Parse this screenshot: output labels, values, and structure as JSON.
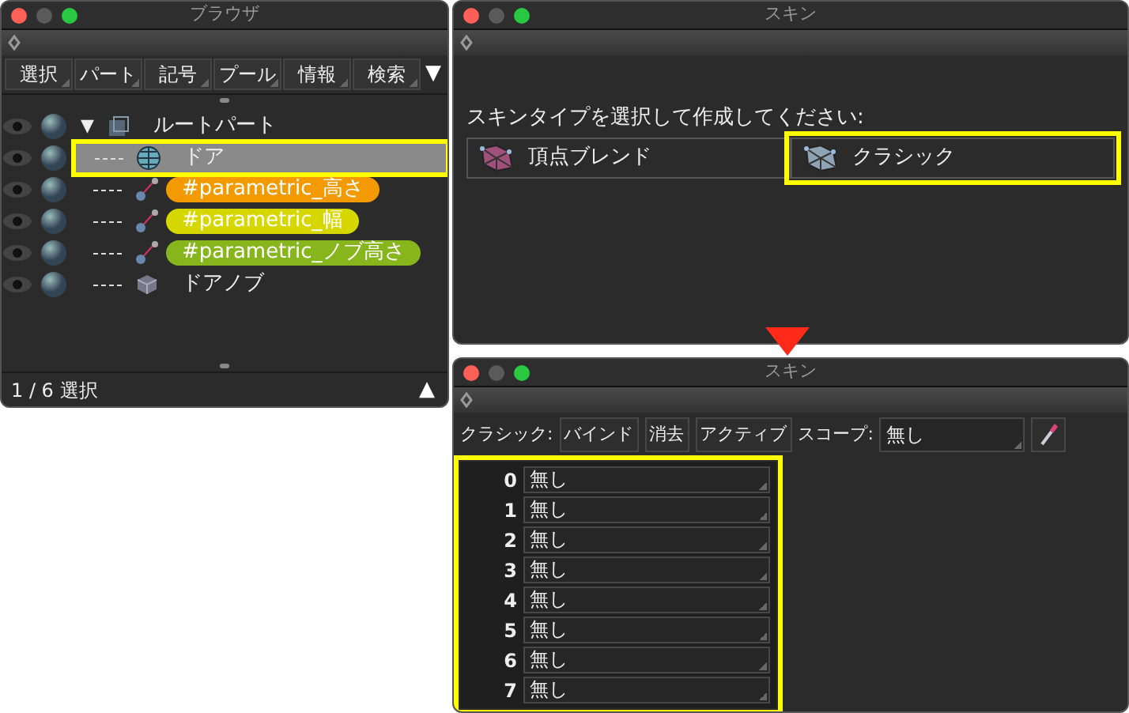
{
  "browser": {
    "title": "ブラウザ",
    "tabs": [
      "選択",
      "パート",
      "記号",
      "プール",
      "情報",
      "検索"
    ],
    "tab_menu": "▼",
    "tree": [
      {
        "label": "ルートパート",
        "kind": "part",
        "expanded": true,
        "toggle": "▼",
        "selected": false,
        "highlighted": false,
        "children": [
          {
            "label": "ドア",
            "kind": "mesh",
            "selected": true,
            "highlighted": true
          },
          {
            "label": "#parametric_高さ",
            "kind": "param",
            "color": "#f29a00",
            "selected": false,
            "highlighted": false
          },
          {
            "label": "#parametric_幅",
            "kind": "param",
            "color": "#d7d700",
            "selected": false,
            "highlighted": false
          },
          {
            "label": "#parametric_ノブ高さ",
            "kind": "param",
            "color": "#86b51c",
            "selected": false,
            "highlighted": false
          },
          {
            "label": "ドアノブ",
            "kind": "box",
            "selected": false,
            "highlighted": false
          }
        ]
      }
    ],
    "status": "1 / 6 選択",
    "status_button": "▲"
  },
  "skin_type": {
    "title": "スキン",
    "prompt": "スキンタイプを選択して作成してください:",
    "options": [
      {
        "label": "頂点ブレンド",
        "color": "#a0507a",
        "highlighted": false
      },
      {
        "label": "クラシック",
        "color": "#8fa3b5",
        "highlighted": true
      }
    ]
  },
  "skin": {
    "title": "スキン",
    "label": "クラシック:",
    "buttons": [
      "バインド",
      "消去",
      "アクティブ"
    ],
    "scope_label": "スコープ:",
    "scope_value": "無し",
    "slots_highlighted": true,
    "slots": [
      {
        "index": "0",
        "value": "無し"
      },
      {
        "index": "1",
        "value": "無し"
      },
      {
        "index": "2",
        "value": "無し"
      },
      {
        "index": "3",
        "value": "無し"
      },
      {
        "index": "4",
        "value": "無し"
      },
      {
        "index": "5",
        "value": "無し"
      },
      {
        "index": "6",
        "value": "無し"
      },
      {
        "index": "7",
        "value": "無し"
      }
    ]
  }
}
